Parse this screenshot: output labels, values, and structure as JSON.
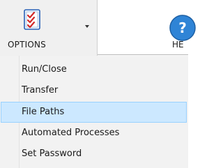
{
  "ribbon": {
    "options_label": "OPTIONS",
    "options_icon": "checklist-icon",
    "dropdown_icon": "dropdown-arrow-icon",
    "help_label": "HE",
    "help_icon": "help-icon"
  },
  "menu": {
    "items": [
      {
        "label": "Run/Close"
      },
      {
        "label": "Transfer"
      },
      {
        "label": "File Paths",
        "selected": true
      },
      {
        "label": "Automated Processes"
      },
      {
        "label": "Set Password"
      }
    ]
  },
  "colors": {
    "highlight": "#cce8ff",
    "highlight_border": "#99d1ff",
    "menu_background": "#f2f2f2",
    "icon_check": "#d22a2a",
    "icon_outline": "#2a62b8",
    "help_blue": "#2f84d6"
  }
}
